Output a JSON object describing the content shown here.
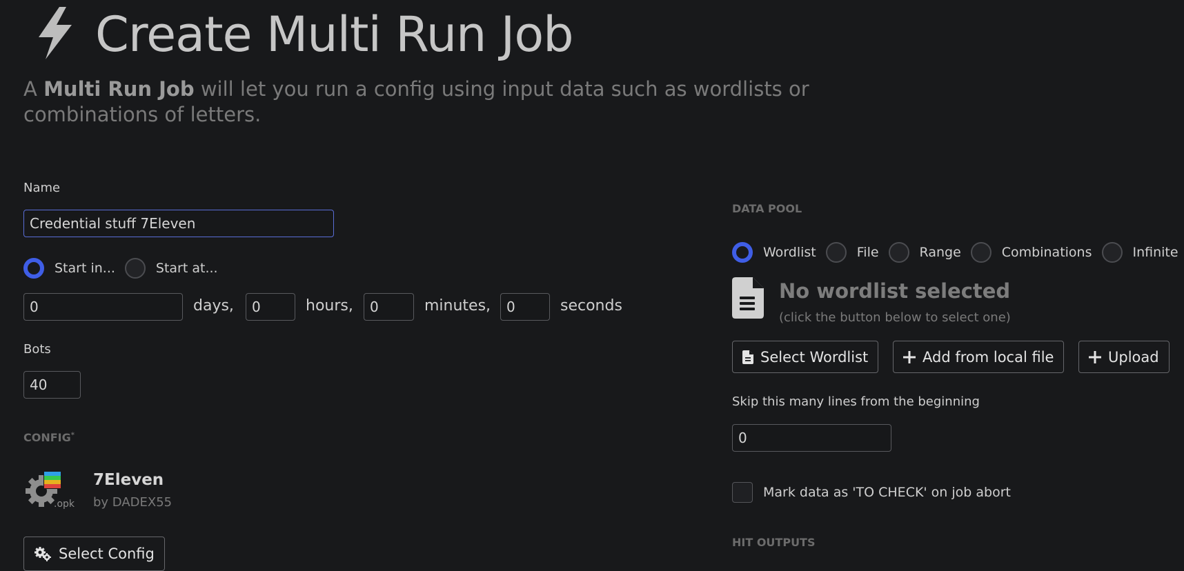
{
  "header": {
    "title": "Create Multi Run Job",
    "subtitle_prefix": "A ",
    "subtitle_bold": "Multi Run Job",
    "subtitle_rest": " will let you run a config using input data such as wordlists or combinations of letters."
  },
  "form": {
    "name_label": "Name",
    "name_value": "Credential stuff 7Eleven",
    "start_options": [
      {
        "label": "Start in...",
        "selected": true
      },
      {
        "label": "Start at...",
        "selected": false
      }
    ],
    "delay": {
      "days_value": "0",
      "days_label": "days,",
      "hours_value": "0",
      "hours_label": "hours,",
      "minutes_value": "0",
      "minutes_label": "minutes,",
      "seconds_value": "0",
      "seconds_label": "seconds"
    },
    "bots_label": "Bots",
    "bots_value": "40",
    "config_section": "CONFIG",
    "config_required_mark": "*",
    "config": {
      "name": "7Eleven",
      "author": "by DADEX55",
      "icon_ext": ".opk"
    },
    "select_config_label": "Select Config"
  },
  "data_pool": {
    "section": "DATA POOL",
    "types": [
      {
        "label": "Wordlist",
        "selected": true
      },
      {
        "label": "File",
        "selected": false
      },
      {
        "label": "Range",
        "selected": false
      },
      {
        "label": "Combinations",
        "selected": false
      },
      {
        "label": "Infinite",
        "selected": false
      }
    ],
    "empty_title": "No wordlist selected",
    "empty_hint": "(click the button below to select one)",
    "buttons": {
      "select_wordlist": "Select Wordlist",
      "add_local": "Add from local file",
      "upload": "Upload"
    },
    "skip_label": "Skip this many lines from the beginning",
    "skip_value": "0",
    "mark_to_check_label": "Mark data as 'TO CHECK' on job abort",
    "mark_to_check_checked": false
  },
  "hit_outputs": {
    "section": "HIT OUTPUTS"
  },
  "colors": {
    "accent": "#3f5ee6",
    "background": "#18191b"
  }
}
